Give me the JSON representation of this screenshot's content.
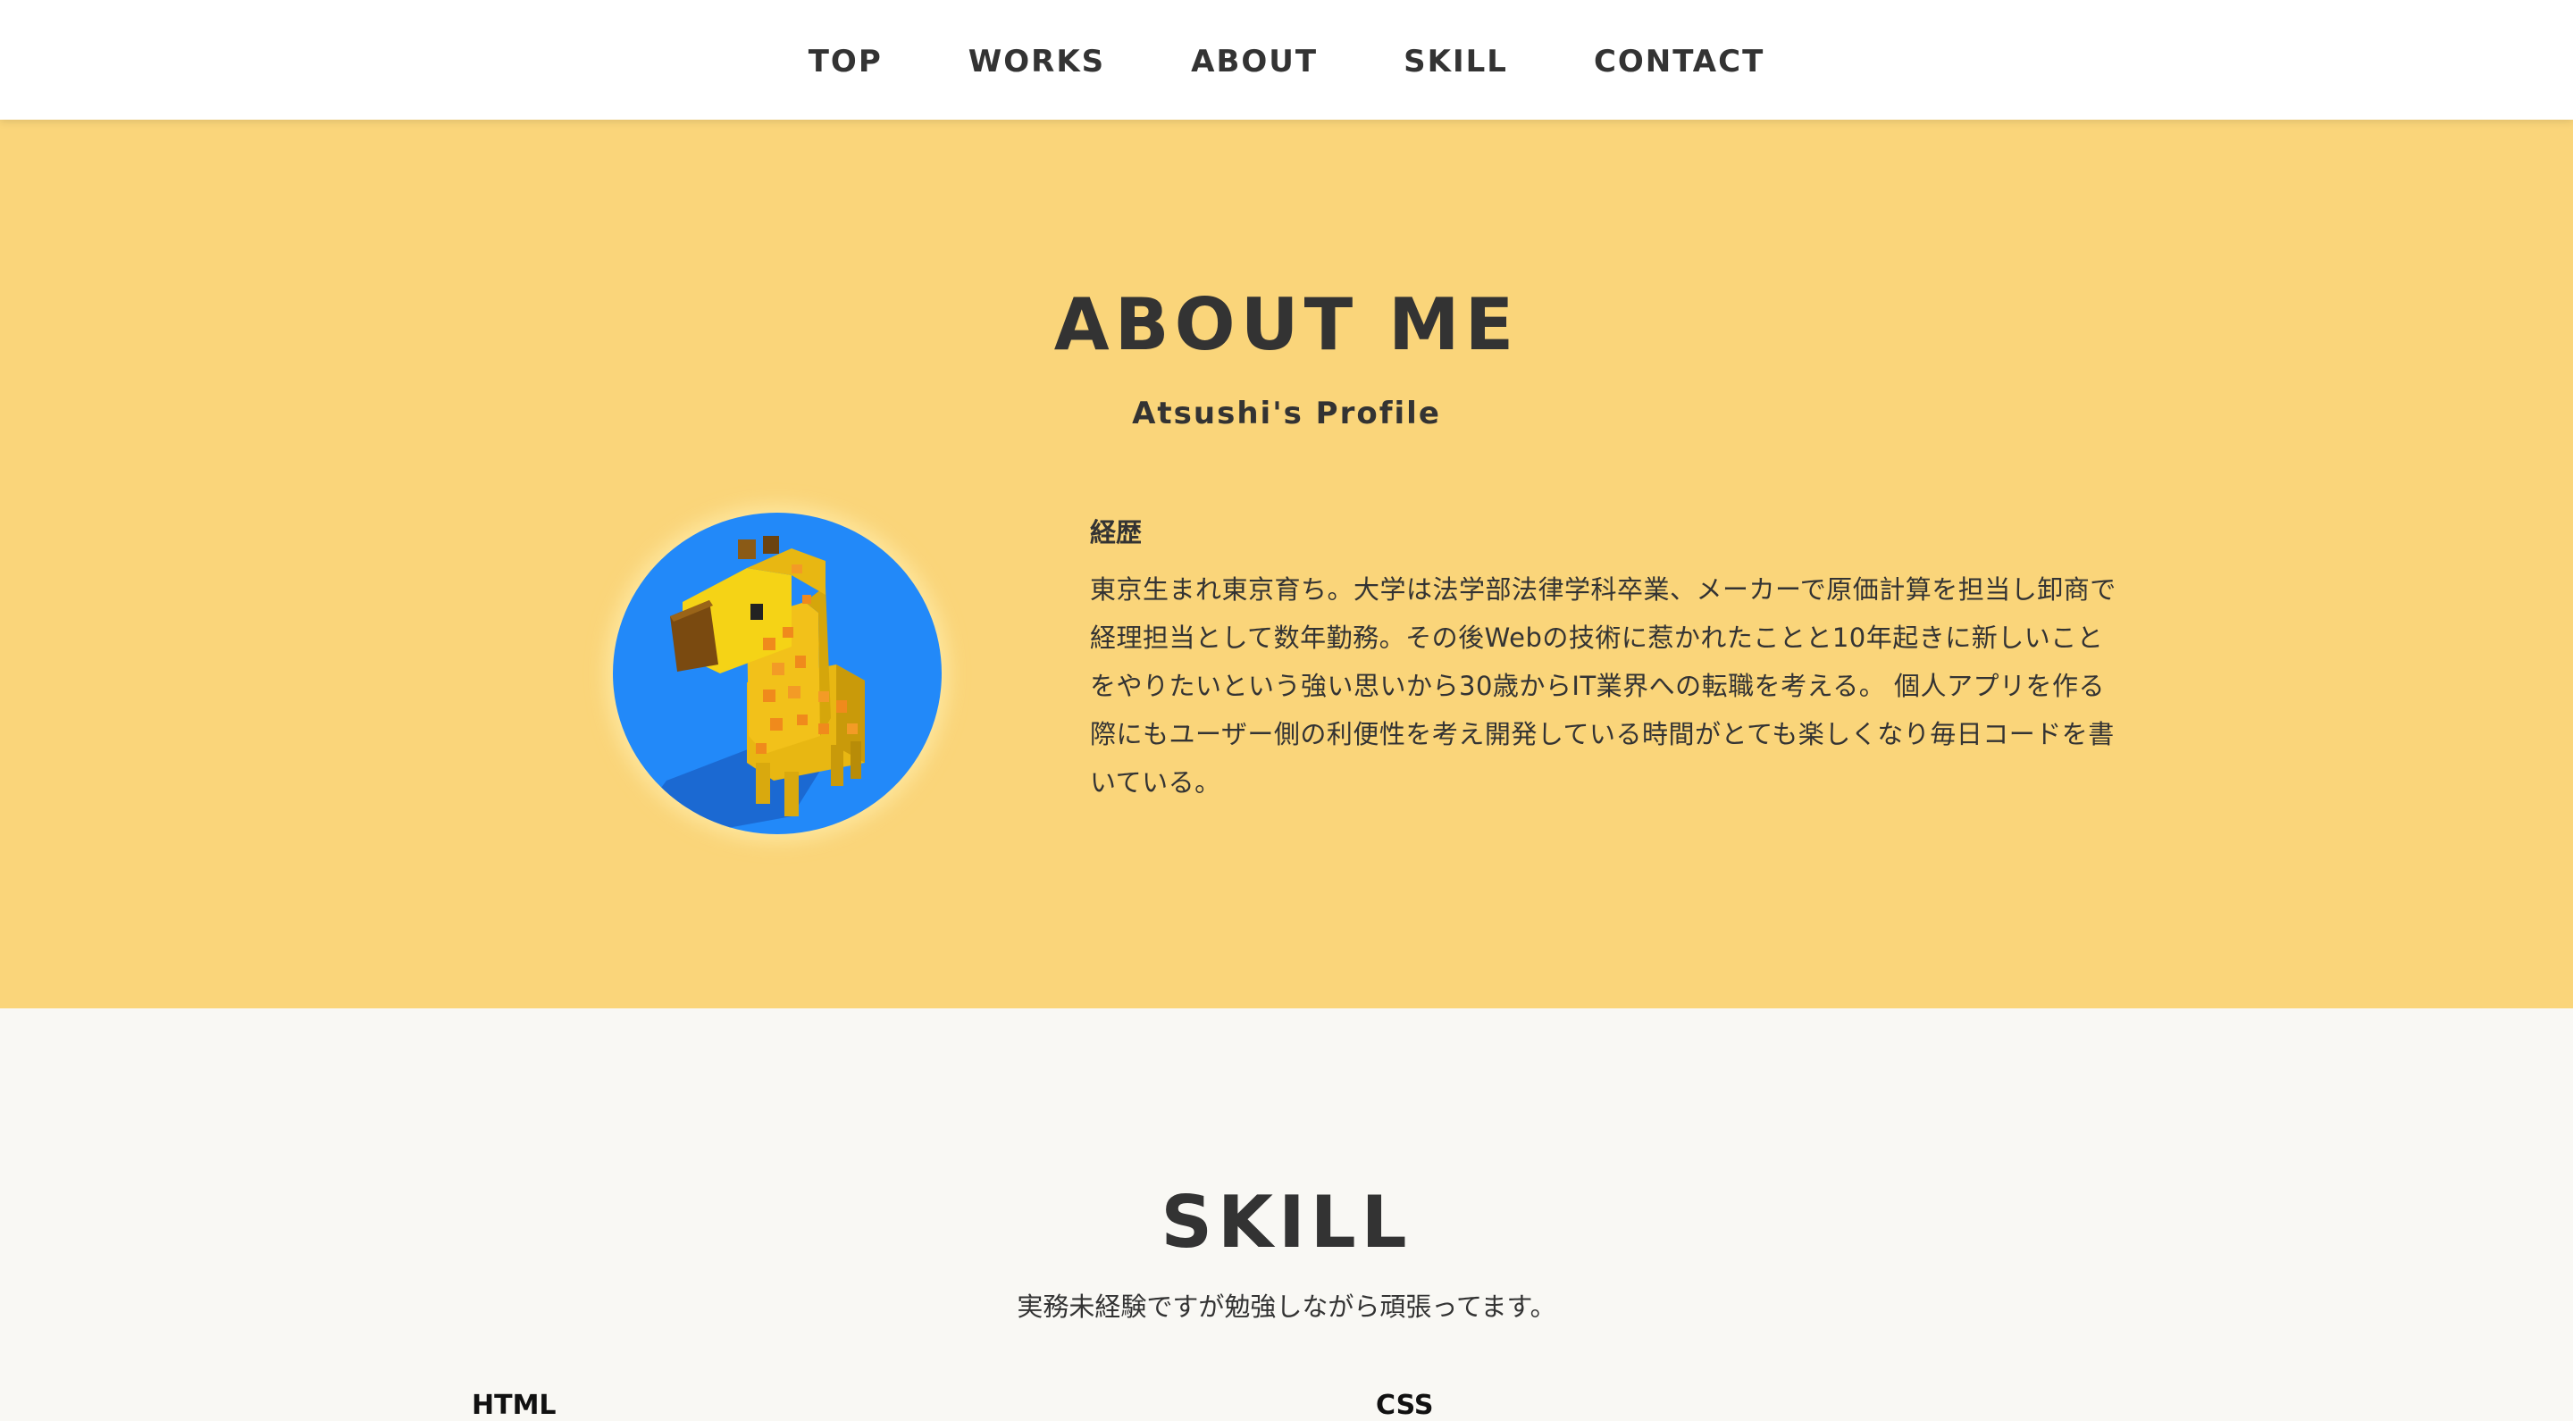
{
  "nav": {
    "items": [
      {
        "label": "TOP"
      },
      {
        "label": "WORKS"
      },
      {
        "label": "ABOUT"
      },
      {
        "label": "SKILL"
      },
      {
        "label": "CONTACT"
      }
    ]
  },
  "about": {
    "title": "ABOUT ME",
    "subtitle": "Atsushi's Profile",
    "avatar_icon": "giraffe-voxel-icon",
    "career_heading": "経歴",
    "career_text": "東京生まれ東京育ち。大学は法学部法律学科卒業、メーカーで原価計算を担当し卸商で経理担当として数年勤務。その後Webの技術に惹かれたことと10年起きに新しいことをやりたいという強い思いから30歳からIT業界への転職を考える。 個人アプリを作る際にもユーザー側の利便性を考え開発している時間がとても楽しくなり毎日コードを書いている。"
  },
  "skill": {
    "title": "SKILL",
    "subtitle": "実務未経験ですが勉強しながら頑張ってます。",
    "labels": [
      {
        "label": "HTML"
      },
      {
        "label": "CSS"
      }
    ]
  },
  "colors": {
    "about_bg": "#fad57a",
    "skill_bg": "#f9f8f4",
    "text": "#333333",
    "avatar_bg": "#2289f9"
  }
}
